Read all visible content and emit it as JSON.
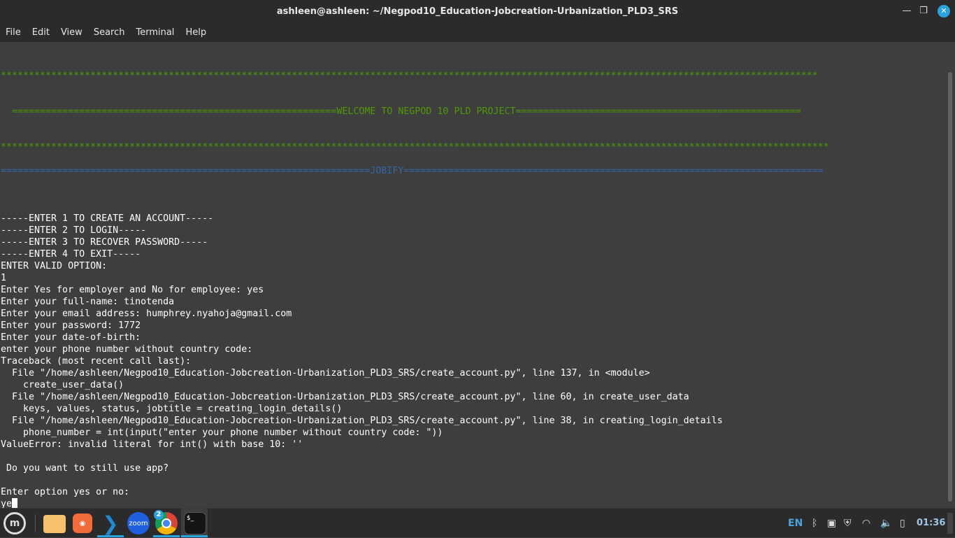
{
  "window": {
    "title": "ashleen@ashleen: ~/Negpod10_Education-Jobcreation-Urbanization_PLD3_SRS"
  },
  "menu": [
    "File",
    "Edit",
    "View",
    "Search",
    "Terminal",
    "Help"
  ],
  "colors": {
    "green": "#4e9a06",
    "blue": "#3465a4",
    "accent": "#2ba2e0"
  },
  "terminal": {
    "lines": [
      {
        "t": "**************************************************************************************************************************************************",
        "c": "green"
      },
      {
        "t": ""
      },
      {
        "t": ""
      },
      {
        "t": "  ==========================================================WELCOME TO NEGPOD 10 PLD PROJECT===================================================",
        "c": "green"
      },
      {
        "t": ""
      },
      {
        "t": ""
      },
      {
        "t": "****************************************************************************************************************************************************",
        "c": "green"
      },
      {
        "t": ""
      },
      {
        "t": "==================================================================JOBIFY===========================================================================",
        "c": "blue"
      },
      {
        "t": ""
      },
      {
        "t": ""
      },
      {
        "t": ""
      },
      {
        "t": "-----ENTER 1 TO CREATE AN ACCOUNT-----"
      },
      {
        "t": "-----ENTER 2 TO LOGIN-----"
      },
      {
        "t": "-----ENTER 3 TO RECOVER PASSWORD-----"
      },
      {
        "t": "-----ENTER 4 TO EXIT-----"
      },
      {
        "t": "ENTER VALID OPTION:"
      },
      {
        "t": "1"
      },
      {
        "t": "Enter Yes for employer and No for employee: yes"
      },
      {
        "t": "Enter your full-name: tinotenda"
      },
      {
        "t": "Enter your email address: humphrey.nyahoja@gmail.com"
      },
      {
        "t": "Enter your password: 1772"
      },
      {
        "t": "Enter your date-of-birth:"
      },
      {
        "t": "enter your phone number without country code:"
      },
      {
        "t": "Traceback (most recent call last):"
      },
      {
        "t": "  File \"/home/ashleen/Negpod10_Education-Jobcreation-Urbanization_PLD3_SRS/create_account.py\", line 137, in <module>"
      },
      {
        "t": "    create_user_data()"
      },
      {
        "t": "  File \"/home/ashleen/Negpod10_Education-Jobcreation-Urbanization_PLD3_SRS/create_account.py\", line 60, in create_user_data"
      },
      {
        "t": "    keys, values, status, jobtitle = creating_login_details()"
      },
      {
        "t": "  File \"/home/ashleen/Negpod10_Education-Jobcreation-Urbanization_PLD3_SRS/create_account.py\", line 38, in creating_login_details"
      },
      {
        "t": "    phone_number = int(input(\"enter your phone number without country code: \"))"
      },
      {
        "t": "ValueError: invalid literal for int() with base 10: ''"
      },
      {
        "t": ""
      },
      {
        "t": " Do you want to still use app?"
      },
      {
        "t": ""
      },
      {
        "t": "Enter option yes or no:"
      },
      {
        "t": "ye",
        "cursor": true
      }
    ]
  },
  "taskbar": {
    "apps": [
      {
        "name": "files",
        "icon": "folder-icon"
      },
      {
        "name": "firefox",
        "icon": "firefox-icon"
      },
      {
        "name": "vscode",
        "icon": "vscode-icon"
      },
      {
        "name": "zoom",
        "icon": "zoom-icon",
        "label": "zoom"
      },
      {
        "name": "chrome",
        "icon": "chrome-icon",
        "badge": "2"
      },
      {
        "name": "terminal",
        "icon": "terminal-icon",
        "label": "$_"
      }
    ],
    "tray": {
      "language": "EN",
      "clock": "01:36"
    }
  }
}
